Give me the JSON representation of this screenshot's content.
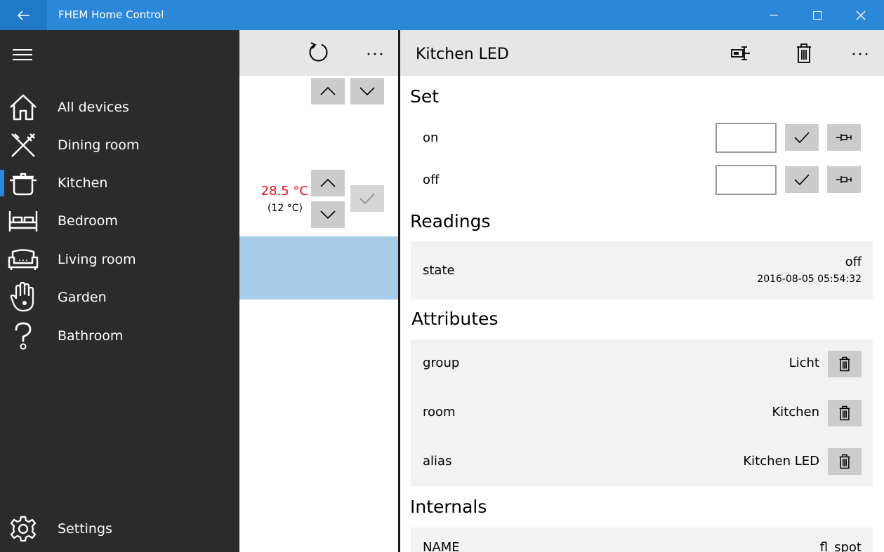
{
  "window": {
    "title": "FHEM Home Control",
    "back_icon": "back-arrow-icon",
    "accent_color": "#2b88d8"
  },
  "sidebar": {
    "items": [
      {
        "label": "All devices",
        "icon": "home-icon"
      },
      {
        "label": "Dining room",
        "icon": "cutlery-icon"
      },
      {
        "label": "Kitchen",
        "icon": "cooking-pot-icon",
        "active": true
      },
      {
        "label": "Bedroom",
        "icon": "bed-icon"
      },
      {
        "label": "Living room",
        "icon": "sofa-icon"
      },
      {
        "label": "Garden",
        "icon": "hand-flower-icon"
      },
      {
        "label": "Bathroom",
        "icon": "question-icon"
      }
    ],
    "settings_label": "Settings"
  },
  "device_list": {
    "temperature": "28.5 °C",
    "temperature_color": "#e81123",
    "target": "(12 °C)"
  },
  "detail": {
    "device_title": "Kitchen LED",
    "set": {
      "title": "Set",
      "commands": [
        {
          "label": "on",
          "value": ""
        },
        {
          "label": "off",
          "value": ""
        }
      ]
    },
    "readings": {
      "title": "Readings",
      "items": [
        {
          "name": "state",
          "value": "off",
          "timestamp": "2016-08-05 05:54:32"
        }
      ]
    },
    "attributes": {
      "title": "Attributes",
      "items": [
        {
          "name": "group",
          "value": "Licht"
        },
        {
          "name": "room",
          "value": "Kitchen"
        },
        {
          "name": "alias",
          "value": "Kitchen LED"
        }
      ]
    },
    "internals": {
      "title": "Internals",
      "items": [
        {
          "name": "NAME",
          "value": "fl_spot"
        }
      ]
    }
  }
}
